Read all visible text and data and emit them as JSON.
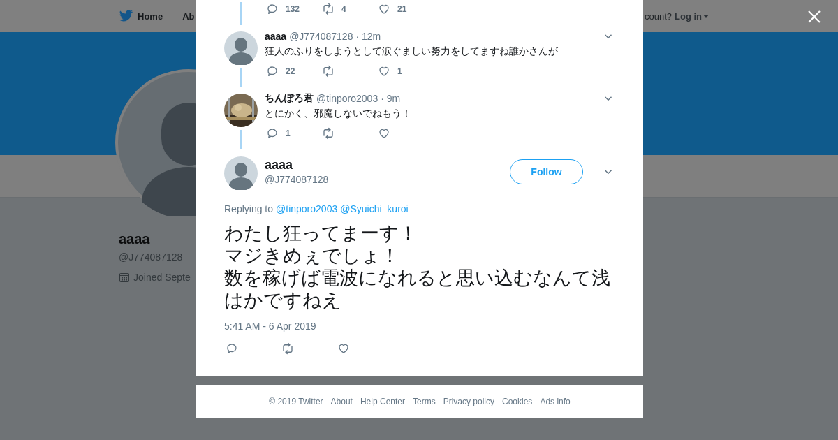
{
  "nav": {
    "items": [
      {
        "label": "Home",
        "kind": "home"
      },
      {
        "label": "Ab",
        "kind": "link"
      }
    ],
    "login_prompt": "count?",
    "login": "Log in"
  },
  "profile": {
    "name": "aaaa",
    "handle": "@J774087128",
    "joined": "Joined Septe"
  },
  "thread": [
    {
      "kind": "partial",
      "replies": "132",
      "retweets": "4",
      "likes": "21"
    },
    {
      "kind": "tweet",
      "avatar": {
        "kind": "default"
      },
      "name": "aaaa",
      "handle": "@J774087128",
      "time": "· 12m",
      "text": "狂人のふりをしようとして涙ぐましい努力をしてますね誰かさんが",
      "replies": "22",
      "likes": "1"
    },
    {
      "kind": "tweet",
      "name": "ちんぽろ君",
      "handle": "@tinporo2003",
      "time": "· 9m",
      "text": "とにかく、邪魔しないでねもう！",
      "replies": "1"
    }
  ],
  "main_tweet": {
    "avatar": {
      "kind": "default"
    },
    "name": "aaaa",
    "handle": "@J774087128",
    "follow": "Follow",
    "replying_prefix": "Replying to",
    "mentions": [
      "@tinporo2003",
      "@Syuichi_kuroi"
    ],
    "text_lines": [
      "わたし狂ってまーす！",
      "マジきめぇでしょ！",
      "数を稼げば電波になれると思い込むなんて浅はかですねえ"
    ],
    "timestamp": "5:41 AM - 6 Apr 2019"
  },
  "footer": [
    "© 2019 Twitter",
    "About",
    "Help Center",
    "Terms",
    "Privacy policy",
    "Cookies",
    "Ads info"
  ]
}
